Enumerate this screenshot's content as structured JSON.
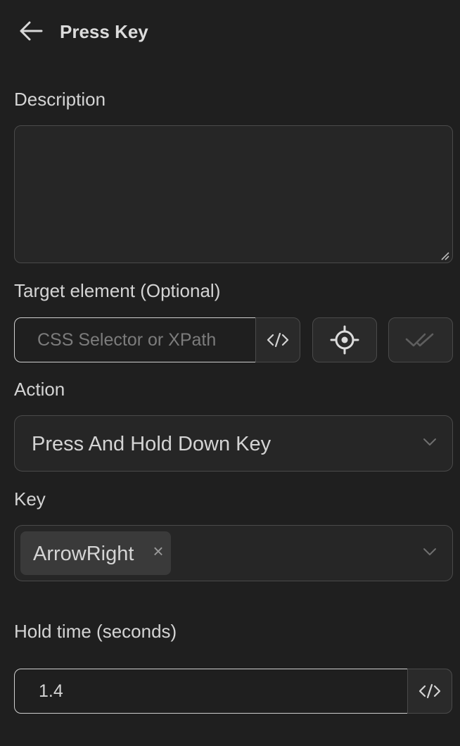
{
  "header": {
    "title": "Press Key",
    "back_icon": "arrow-left-icon"
  },
  "description": {
    "label": "Description",
    "value": ""
  },
  "target": {
    "label": "Target element (Optional)",
    "placeholder": "CSS Selector or XPath",
    "value": "",
    "code_icon": "code-icon",
    "picker_icon": "crosshair-icon",
    "verify_icon": "double-check-icon"
  },
  "action": {
    "label": "Action",
    "selected": "Press And Hold Down Key"
  },
  "key": {
    "label": "Key",
    "tags": [
      "ArrowRight"
    ],
    "remove_glyph": "×"
  },
  "hold_time": {
    "label": "Hold time (seconds)",
    "value": "1.4",
    "code_icon": "code-icon"
  },
  "colors": {
    "background": "#1f1f1f",
    "input_background": "#262626",
    "border": "#4a4a4a",
    "focus_border": "#cfcfcf",
    "text": "#d4d4d4",
    "placeholder": "#7c7c7c",
    "tag_background": "#3a3a3a"
  }
}
